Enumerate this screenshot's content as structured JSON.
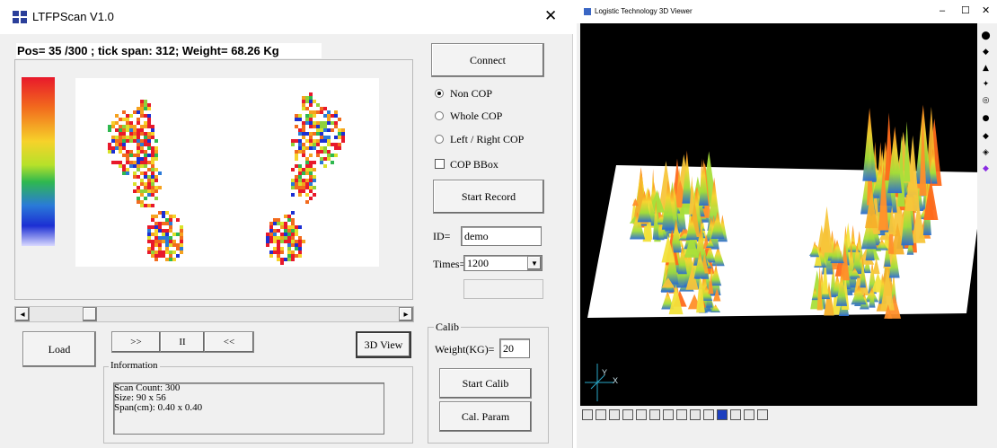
{
  "scan_window": {
    "title": "LTFPScan V1.0",
    "close_glyph": "✕",
    "status_line": "Pos= 35 /300 ; tick span: 312;  Weight= 68.26 Kg",
    "buttons": {
      "connect": "Connect",
      "start_record": "Start Record",
      "load": "Load",
      "forward": ">>",
      "pause": "II",
      "back": "<<",
      "view3d": "3D View",
      "start_calib": "Start Calib",
      "cal_param": "Cal. Param"
    },
    "cop_options": [
      "Non COP",
      "Whole COP",
      "Left / Right COP"
    ],
    "cop_selected": 0,
    "bbox_label": "COP BBox",
    "id_label": "ID=",
    "id_value": "demo",
    "times_label": "Times=",
    "times_value": "1200",
    "scroll_left": "◂",
    "scroll_right": "▸",
    "scroll_position": 0.15,
    "calib": {
      "group_label": "Calib",
      "weight_label": "Weight(KG)=",
      "weight_value": "20"
    },
    "information": {
      "group_label": "Information",
      "lines": [
        "Scan Count: 300",
        "Size: 90 x 56",
        "Span(cm): 0.40 x 0.40"
      ]
    },
    "colors": {
      "colorbar": [
        "#e8192b",
        "#f26b1d",
        "#f6d22a",
        "#b6e12a",
        "#2fb84f",
        "#2a7ad8",
        "#1c2fd3",
        "#d8d8ff"
      ]
    }
  },
  "viewer_window": {
    "title": "Logistic Technology 3D Viewer",
    "controls": [
      "–",
      "☐",
      "✕"
    ],
    "axis_y": "Y",
    "axis_x": "X",
    "toolbar_icon_names": [
      "rotate-icon",
      "pan-icon",
      "zoom-icon",
      "light-icon",
      "grid-icon",
      "reset-icon",
      "shade-icon",
      "wire-icon",
      "color-icon",
      "palette-icon",
      "export-icon"
    ],
    "bottom_toolbar_icon_names": [
      "view-front-icon",
      "view-back-icon",
      "view-left-icon",
      "view-right-icon",
      "view-top-icon",
      "table-icon",
      "grid2-icon",
      "zoom-fit-icon",
      "graph-icon",
      "frame-icon",
      "fill-icon",
      "lightning-icon",
      "copy-icon",
      "print-icon"
    ]
  }
}
